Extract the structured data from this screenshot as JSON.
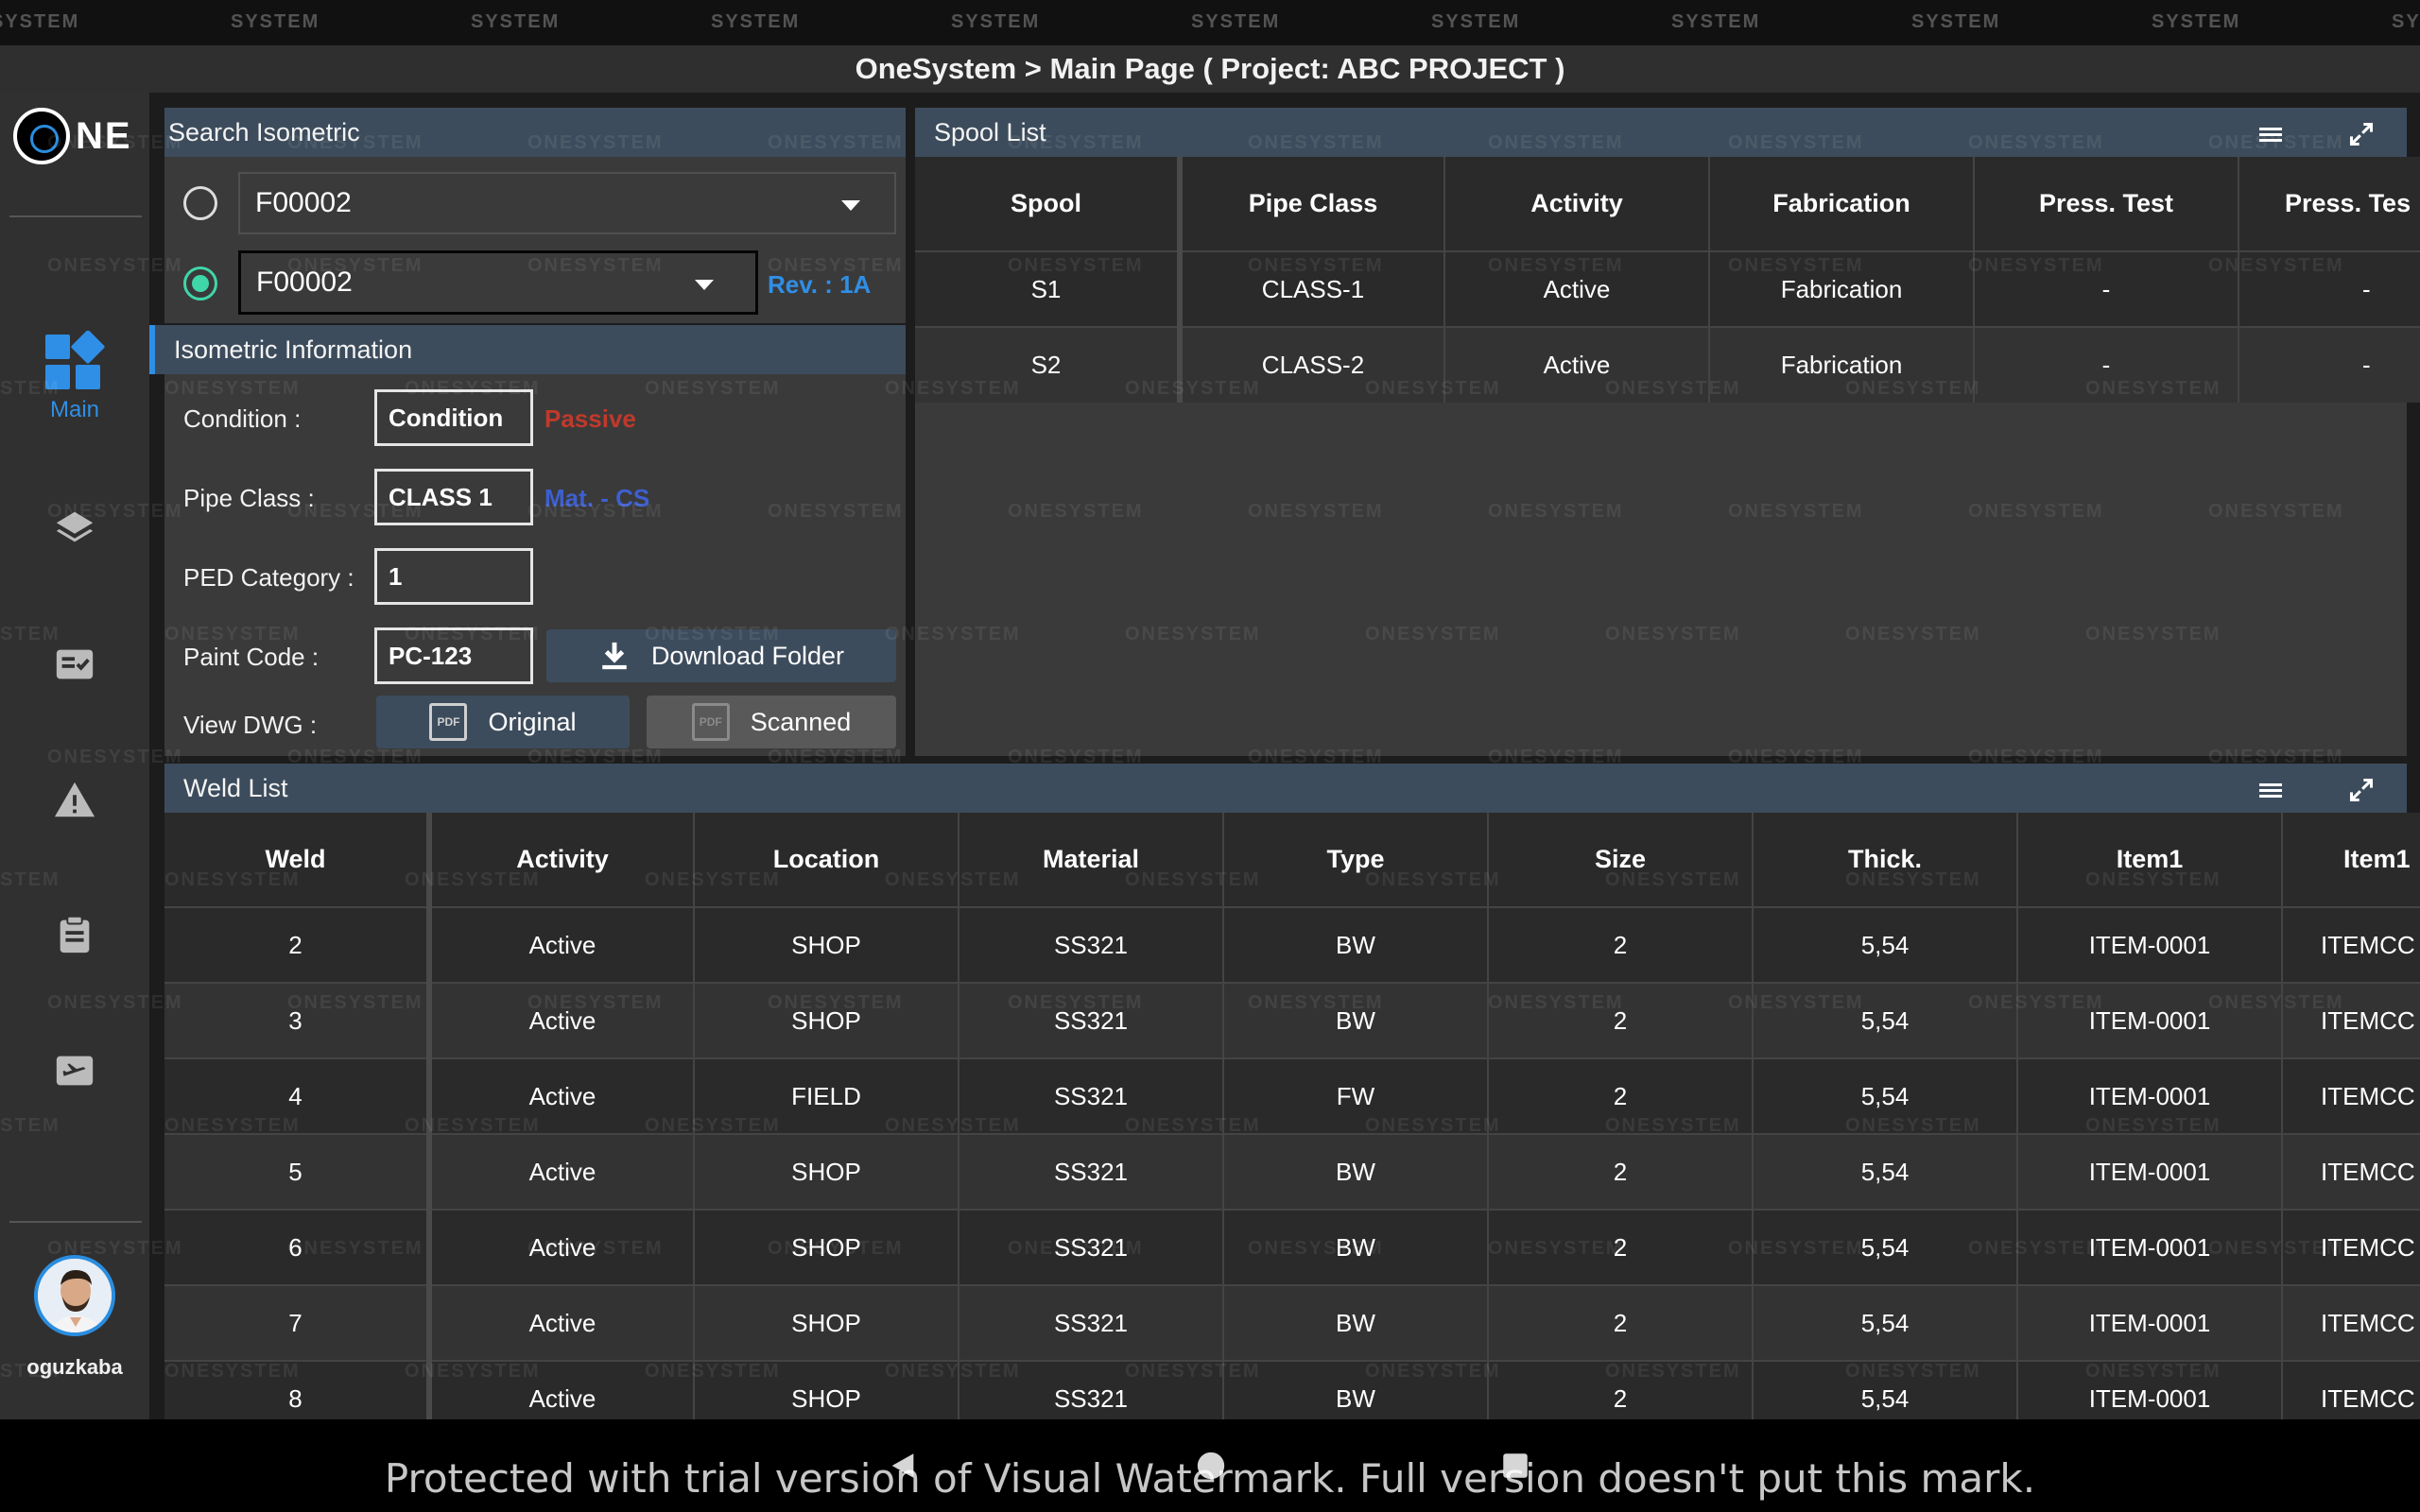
{
  "title": "OneSystem > Main Page ( Project: ABC PROJECT )",
  "logo_text": "NE",
  "sidebar": {
    "items": [
      {
        "name": "main",
        "label": "Main",
        "icon": "dashboard-icon",
        "active": true
      },
      {
        "name": "layers",
        "label": "",
        "icon": "layers-icon"
      },
      {
        "name": "checklist",
        "label": "",
        "icon": "checklist-icon"
      },
      {
        "name": "warning",
        "label": "",
        "icon": "warning-icon"
      },
      {
        "name": "clipboard",
        "label": "",
        "icon": "clipboard-icon"
      },
      {
        "name": "transfer",
        "label": "",
        "icon": "flight-icon"
      }
    ],
    "username": "oguzkaba"
  },
  "search": {
    "title": "Search Isometric",
    "select1": "F00002",
    "select2": "F00002",
    "revision": "Rev. : 1A"
  },
  "iso_info": {
    "title": "Isometric Information",
    "condition_label": "Condition :",
    "condition_value": "Condition",
    "condition_status": "Passive",
    "pipe_class_label": "Pipe Class :",
    "pipe_class_value": "CLASS 1",
    "material": "Mat. - CS",
    "ped_label": "PED Category :",
    "ped_value": "1",
    "paint_label": "Paint Code :",
    "paint_value": "PC-123",
    "download_label": "Download Folder",
    "view_dwg_label": "View DWG :",
    "original_label": "Original",
    "scanned_label": "Scanned",
    "pdf_text": "PDF"
  },
  "spool_list": {
    "title": "Spool List",
    "columns": [
      "Spool",
      "Pipe Class",
      "Activity",
      "Fabrication",
      "Press. Test",
      "Press. Tes"
    ],
    "rows": [
      [
        "S1",
        "CLASS-1",
        "Active",
        "Fabrication",
        "-",
        "-"
      ],
      [
        "S2",
        "CLASS-2",
        "Active",
        "Fabrication",
        "-",
        "-"
      ]
    ]
  },
  "weld_list": {
    "title": "Weld List",
    "columns": [
      "Weld",
      "Activity",
      "Location",
      "Material",
      "Type",
      "Size",
      "Thick.",
      "Item1",
      "Item1"
    ],
    "rows": [
      [
        "2",
        "Active",
        "SHOP",
        "SS321",
        "BW",
        "2",
        "5,54",
        "ITEM-0001",
        "ITEMCC"
      ],
      [
        "3",
        "Active",
        "SHOP",
        "SS321",
        "BW",
        "2",
        "5,54",
        "ITEM-0001",
        "ITEMCC"
      ],
      [
        "4",
        "Active",
        "FIELD",
        "SS321",
        "FW",
        "2",
        "5,54",
        "ITEM-0001",
        "ITEMCC"
      ],
      [
        "5",
        "Active",
        "SHOP",
        "SS321",
        "BW",
        "2",
        "5,54",
        "ITEM-0001",
        "ITEMCC"
      ],
      [
        "6",
        "Active",
        "SHOP",
        "SS321",
        "BW",
        "2",
        "5,54",
        "ITEM-0001",
        "ITEMCC"
      ],
      [
        "7",
        "Active",
        "SHOP",
        "SS321",
        "BW",
        "2",
        "5,54",
        "ITEM-0001",
        "ITEMCC"
      ],
      [
        "8",
        "Active",
        "SHOP",
        "SS321",
        "BW",
        "2",
        "5,54",
        "ITEM-0001",
        "ITEMCC"
      ]
    ]
  },
  "watermark": {
    "main": "ONESYSTEM",
    "top": "SYSTEM"
  },
  "trial_notice": "Protected with trial version of Visual Watermark. Full version doesn't put this mark.",
  "colors": {
    "accent": "#2f8fe6",
    "panel_header": "#3d4c5c",
    "passive": "#c0392b",
    "material": "#3d5fd0",
    "radio_active": "#3fd6a8"
  }
}
